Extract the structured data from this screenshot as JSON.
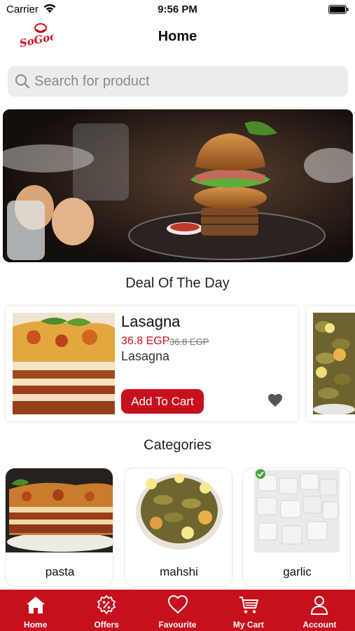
{
  "status_bar": {
    "carrier": "Carrier",
    "time": "9:56 PM"
  },
  "nav": {
    "title": "Home",
    "logo_text": "SoGood"
  },
  "search": {
    "placeholder": "Search for product"
  },
  "deal_section": {
    "title": "Deal Of The Day",
    "items": [
      {
        "name": "Lasagna",
        "price": "36.8 EGP",
        "old_price": "36.8 EGP",
        "subtitle": "Lasagna",
        "button": "Add To Cart"
      }
    ]
  },
  "categories_section": {
    "title": "Categories",
    "items": [
      {
        "label": "pasta"
      },
      {
        "label": "mahshi"
      },
      {
        "label": "garlic"
      }
    ]
  },
  "tab_bar": {
    "items": [
      {
        "label": "Home",
        "icon": "home-icon"
      },
      {
        "label": "Offers",
        "icon": "offers-badge-icon"
      },
      {
        "label": "Favourite",
        "icon": "heart-icon"
      },
      {
        "label": "My Cart",
        "icon": "cart-icon"
      },
      {
        "label": "Account",
        "icon": "account-icon"
      }
    ]
  },
  "colors": {
    "brand_red": "#c7101d",
    "search_bg": "#ececee"
  }
}
